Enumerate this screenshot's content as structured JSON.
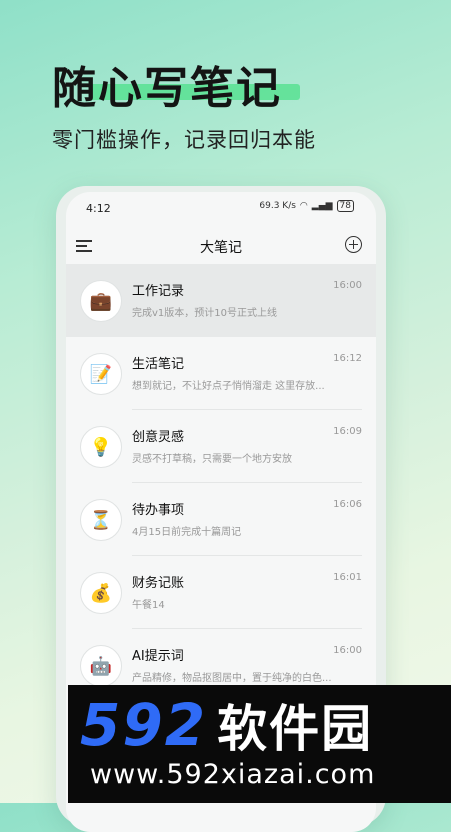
{
  "headline": "随心写笔记",
  "subline": "零门槛操作，记录回归本能",
  "status": {
    "time": "4:12",
    "speed": "69.3 K/s",
    "battery": "78"
  },
  "nav": {
    "title": "大笔记"
  },
  "notes": [
    {
      "icon": "💼",
      "icon_name": "briefcase-icon",
      "title": "工作记录",
      "time": "16:00",
      "preview": "完成v1版本，预计10号正式上线"
    },
    {
      "icon": "📝",
      "icon_name": "memo-icon",
      "title": "生活笔记",
      "time": "16:12",
      "preview": "想到就记，不让好点子悄悄溜走 这里存放..."
    },
    {
      "icon": "💡",
      "icon_name": "lightbulb-icon",
      "title": "创意灵感",
      "time": "16:09",
      "preview": "灵感不打草稿，只需要一个地方安放"
    },
    {
      "icon": "⏳",
      "icon_name": "hourglass-icon",
      "title": "待办事项",
      "time": "16:06",
      "preview": "4月15日前完成十篇周记"
    },
    {
      "icon": "💰",
      "icon_name": "money-bag-icon",
      "title": "财务记账",
      "time": "16:01",
      "preview": "午餐14"
    },
    {
      "icon": "🤖",
      "icon_name": "robot-icon",
      "title": "AI提示词",
      "time": "16:00",
      "preview": "产品精修，物品抠图居中，置于纯净的白色..."
    }
  ],
  "watermark": {
    "number": "592",
    "name": "软件园",
    "url": "www.592xiazai.com"
  }
}
